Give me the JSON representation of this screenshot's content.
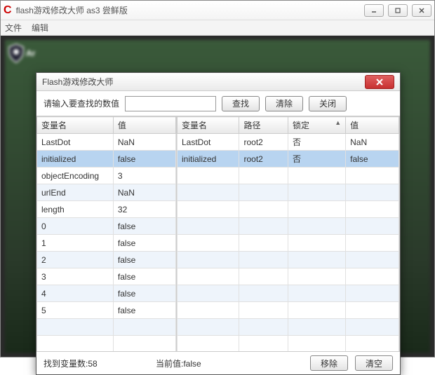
{
  "window": {
    "title": "flash游戏修改大师 as3 尝鲜版"
  },
  "menu": {
    "file": "文件",
    "edit": "编辑"
  },
  "dialog": {
    "title": "Flash游戏修改大师",
    "search_label": "请输入要查找的数值",
    "search_value": "",
    "btn_search": "查找",
    "btn_clear": "清除",
    "btn_close": "关闭",
    "btn_remove": "移除",
    "btn_empty": "清空",
    "status_count_label": "找到变量数:",
    "status_count": "58",
    "status_current_label": "当前值:",
    "status_current": "false"
  },
  "left_table": {
    "headers": {
      "name": "变量名",
      "value": "值"
    },
    "rows": [
      {
        "name": "LastDot",
        "value": "NaN"
      },
      {
        "name": "initialized",
        "value": "false"
      },
      {
        "name": "objectEncoding",
        "value": "3"
      },
      {
        "name": "urlEnd",
        "value": "NaN"
      },
      {
        "name": "length",
        "value": "32"
      },
      {
        "name": "0",
        "value": "false"
      },
      {
        "name": "1",
        "value": "false"
      },
      {
        "name": "2",
        "value": "false"
      },
      {
        "name": "3",
        "value": "false"
      },
      {
        "name": "4",
        "value": "false"
      },
      {
        "name": "5",
        "value": "false"
      }
    ],
    "selected_index": 1
  },
  "right_table": {
    "headers": {
      "name": "变量名",
      "path": "路径",
      "locked": "锁定",
      "value": "值"
    },
    "rows": [
      {
        "name": "LastDot",
        "path": "root2",
        "locked": "否",
        "value": "NaN"
      },
      {
        "name": "initialized",
        "path": "root2",
        "locked": "否",
        "value": "false"
      }
    ],
    "selected_index": 1
  }
}
